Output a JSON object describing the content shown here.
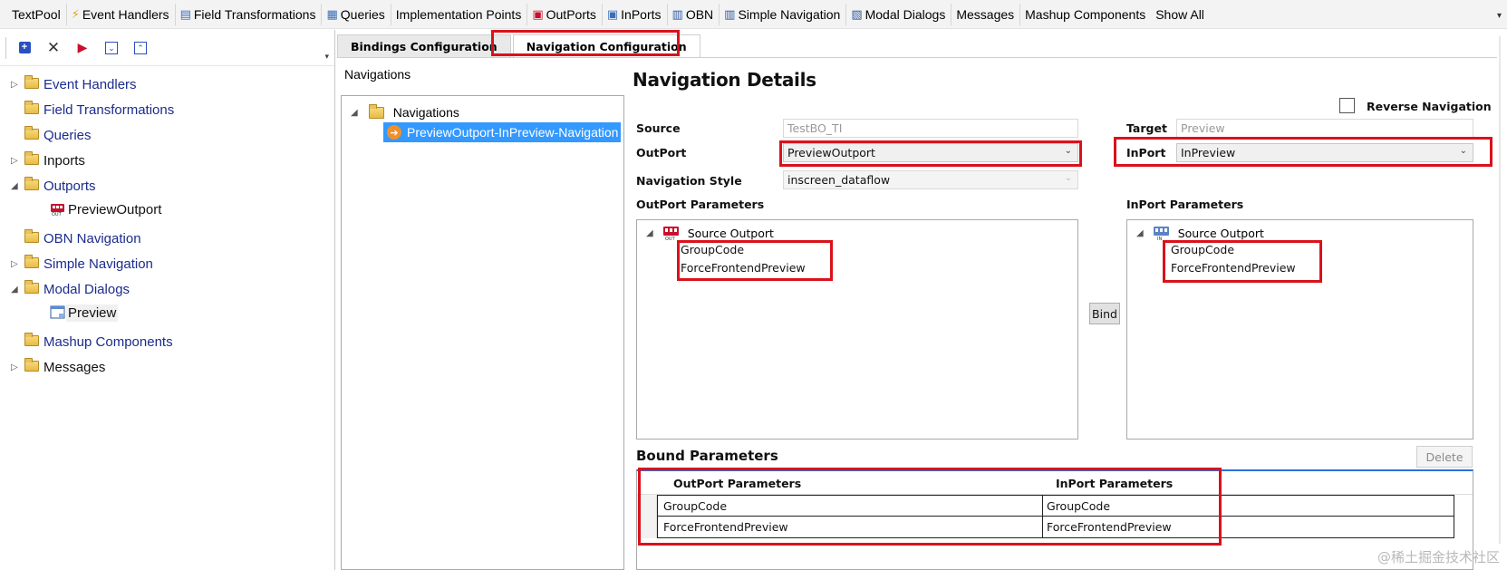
{
  "toolbar": {
    "items": [
      {
        "label": "TextPool",
        "icon": ""
      },
      {
        "label": "Event Handlers",
        "icon": "lightning-icon"
      },
      {
        "label": "Field Transformations",
        "icon": "transform-icon"
      },
      {
        "label": "Queries",
        "icon": "query-icon"
      },
      {
        "label": "Implementation Points",
        "icon": ""
      },
      {
        "label": "OutPorts",
        "icon": "outport-icon"
      },
      {
        "label": "InPorts",
        "icon": "inport-icon"
      },
      {
        "label": "OBN",
        "icon": "obn-icon"
      },
      {
        "label": "Simple Navigation",
        "icon": "navigation-icon"
      },
      {
        "label": "Modal Dialogs",
        "icon": "dialog-icon"
      },
      {
        "label": "Messages",
        "icon": ""
      },
      {
        "label": "Mashup Components",
        "icon": ""
      },
      {
        "label": "Show All",
        "icon": ""
      }
    ]
  },
  "left_tree": {
    "items": [
      {
        "label": "Event Handlers",
        "expander": "collapsed"
      },
      {
        "label": "Field Transformations",
        "expander": "none"
      },
      {
        "label": "Queries",
        "expander": "none"
      },
      {
        "label": "Inports",
        "expander": "collapsed"
      },
      {
        "label": "Outports",
        "expander": "expanded",
        "child": "PreviewOutport"
      },
      {
        "label": "OBN Navigation",
        "expander": "none"
      },
      {
        "label": "Simple Navigation",
        "expander": "collapsed"
      },
      {
        "label": "Modal Dialogs",
        "expander": "expanded",
        "child": "Preview"
      },
      {
        "label": "Mashup Components",
        "expander": "none"
      },
      {
        "label": "Messages",
        "expander": "collapsed"
      }
    ]
  },
  "tabs": {
    "bindings": "Bindings Configuration",
    "navigation": "Navigation Configuration"
  },
  "navigations": {
    "title": "Navigations",
    "root": "Navigations",
    "selected": "PreviewOutport-InPreview-Navigation"
  },
  "details": {
    "title": "Navigation Details",
    "reverse_label": "Reverse Navigation",
    "source_label": "Source",
    "source_value": "TestBO_TI",
    "target_label": "Target",
    "target_value": "Preview",
    "outport_label": "OutPort",
    "outport_value": "PreviewOutport",
    "inport_label": "InPort",
    "inport_value": "InPreview",
    "navstyle_label": "Navigation Style",
    "navstyle_value": "inscreen_dataflow",
    "outport_params_label": "OutPort Parameters",
    "inport_params_label": "InPort Parameters",
    "outport_tree": {
      "root": "Source Outport",
      "items": [
        "GroupCode",
        "ForceFrontendPreview"
      ]
    },
    "inport_tree": {
      "root": "Source Outport",
      "items": [
        "GroupCode",
        "ForceFrontendPreview"
      ]
    },
    "bind_button": "Bind",
    "bound_title": "Bound Parameters",
    "delete_button": "Delete",
    "bound_headers": [
      "OutPort Parameters",
      "InPort Parameters"
    ],
    "bound_rows": [
      [
        "GroupCode",
        "GroupCode"
      ],
      [
        "ForceFrontendPreview",
        "ForceFrontendPreview"
      ]
    ]
  },
  "watermark": "@稀土掘金技术社区",
  "colors": {
    "highlight": "#d9121b",
    "selection": "#3399ff",
    "link": "#1b2c8c"
  }
}
